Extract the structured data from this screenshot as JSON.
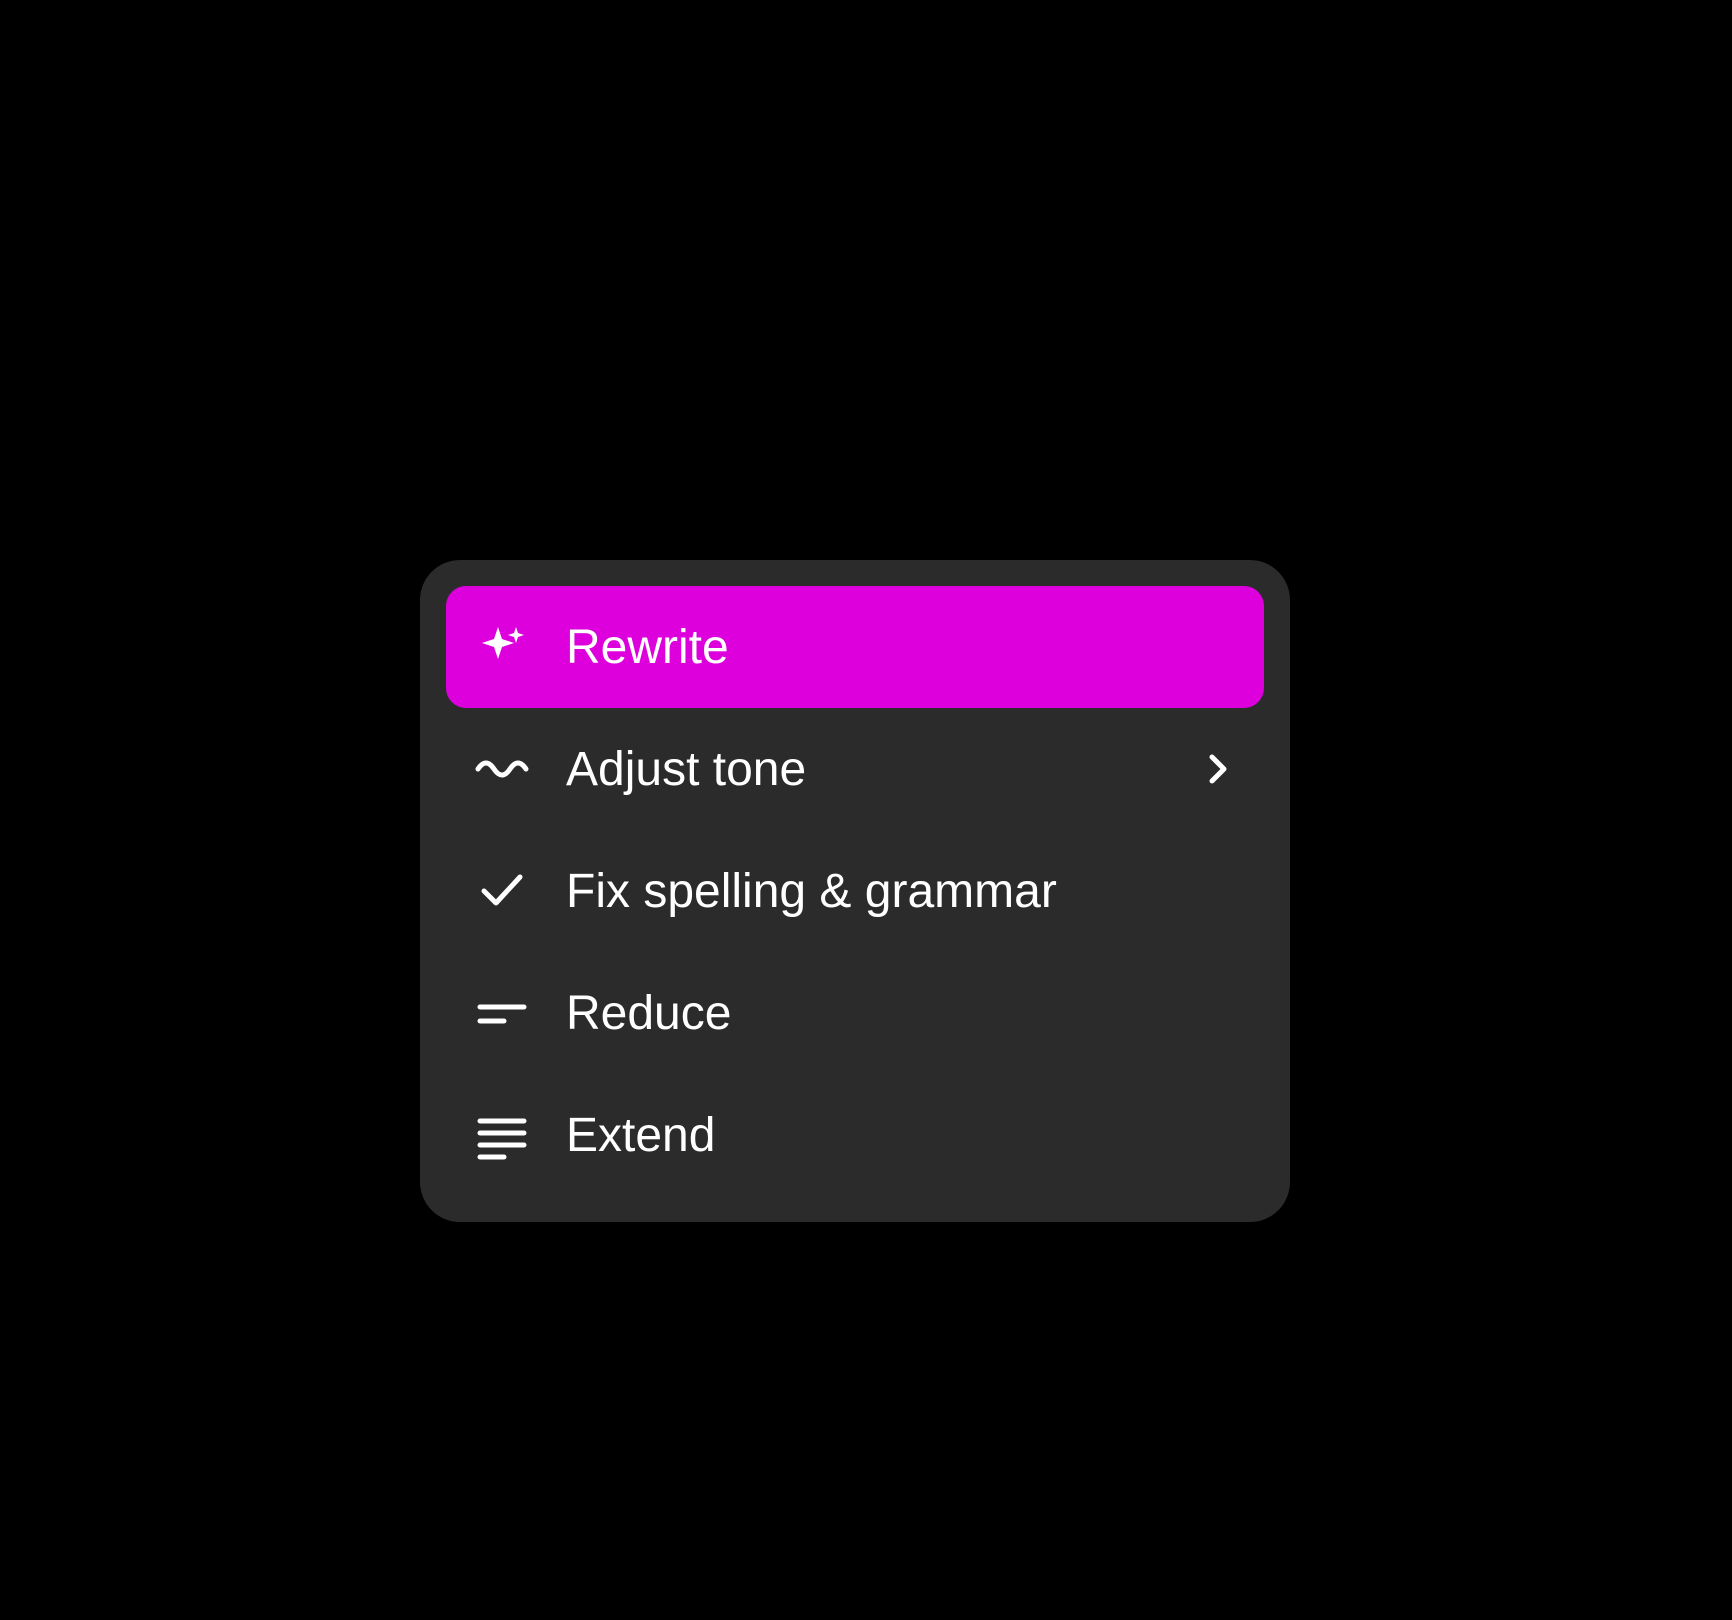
{
  "menu": {
    "items": [
      {
        "label": "Rewrite",
        "icon": "sparkle-icon",
        "selected": true,
        "hasSubmenu": false
      },
      {
        "label": "Adjust tone",
        "icon": "wave-icon",
        "selected": false,
        "hasSubmenu": true
      },
      {
        "label": "Fix spelling & grammar",
        "icon": "checkmark-icon",
        "selected": false,
        "hasSubmenu": false
      },
      {
        "label": "Reduce",
        "icon": "reduce-icon",
        "selected": false,
        "hasSubmenu": false
      },
      {
        "label": "Extend",
        "icon": "extend-icon",
        "selected": false,
        "hasSubmenu": false
      }
    ]
  },
  "colors": {
    "selected": "#dd00dd",
    "menuBackground": "#2b2b2b",
    "text": "#ffffff",
    "pageBackground": "#000000"
  }
}
